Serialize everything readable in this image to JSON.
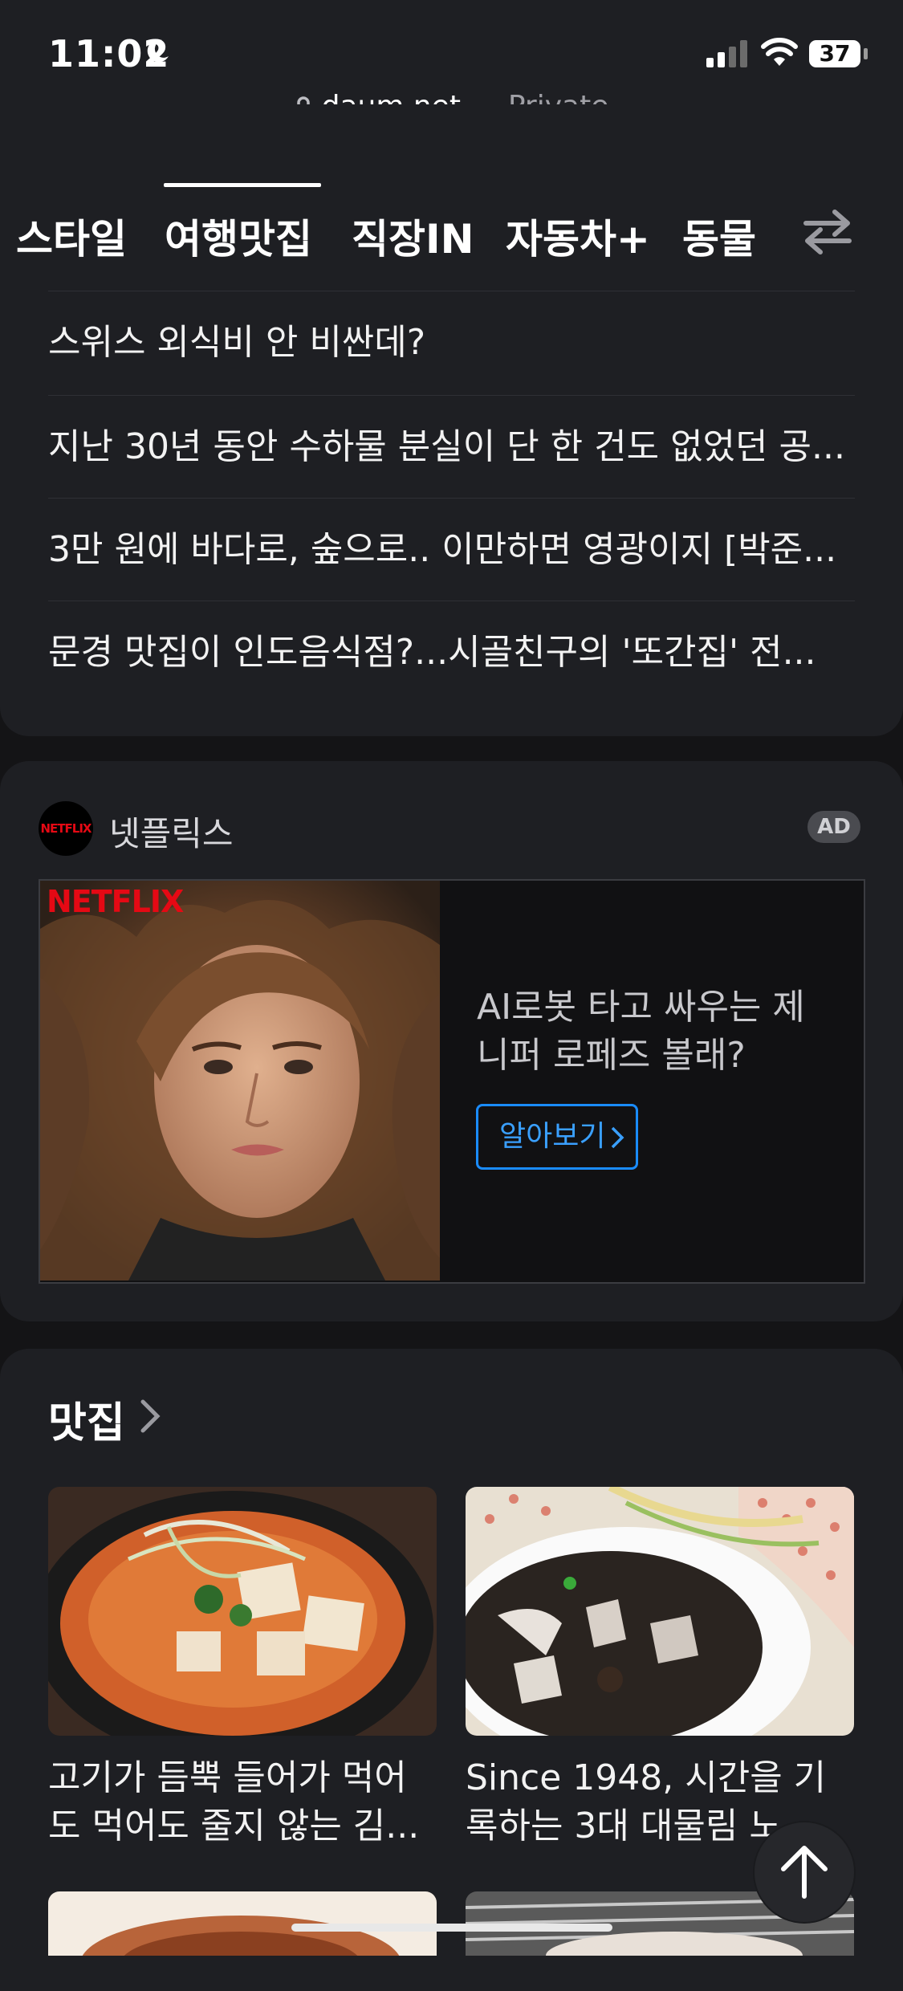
{
  "status_bar": {
    "time": "11:02",
    "battery": "37"
  },
  "address_bar": {
    "domain": "daum.net",
    "mode": "— Private"
  },
  "nav": {
    "tabs": [
      {
        "label": "스타일"
      },
      {
        "label": "여행맛집",
        "active": true
      },
      {
        "label": "직장IN"
      },
      {
        "label": "자동차+"
      },
      {
        "label": "동물"
      }
    ]
  },
  "news_list": {
    "items": [
      "스위스 외식비 안 비싼데?",
      "지난 30년 동안 수하물 분실이 단 한 건도 없었던 공...",
      "3만 원에 바다로, 숲으로.. 이만하면 영광이지 [박준...",
      "문경 맛집이 인도음식점?...시골친구의 '또간집' 전..."
    ]
  },
  "ad": {
    "advertiser": "넷플릭스",
    "logo_text": "NETFLIX",
    "badge": "AD",
    "image_wordmark": "NETFLIX",
    "headline": "AI로봇 타고 싸우는 제니퍼 로페즈 볼래?",
    "cta": "알아보기",
    "accent_color": "#1a8cff"
  },
  "matjip": {
    "title": "맛집",
    "cards": [
      {
        "caption": "고기가 듬뿍 들어가 먹어도 먹어도 줄지 않는 김..."
      },
      {
        "caption": "Since 1948, 시간을 기록하는 3대 대물림 노..."
      }
    ]
  }
}
